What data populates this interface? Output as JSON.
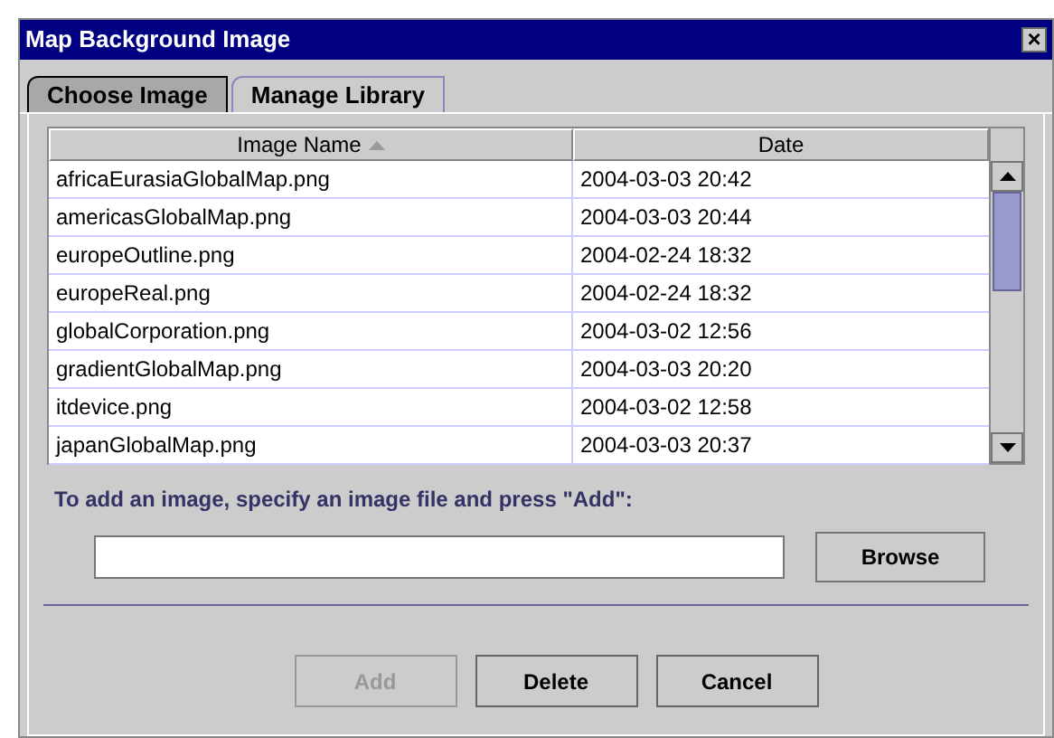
{
  "window": {
    "title": "Map Background Image",
    "close": "×"
  },
  "tabs": [
    {
      "label": "Choose Image",
      "selected": true
    },
    {
      "label": "Manage Library",
      "selected": false
    }
  ],
  "table": {
    "columns": [
      {
        "label": "Image Name",
        "sorted": true
      },
      {
        "label": "Date",
        "sorted": false
      }
    ],
    "rows": [
      [
        "africaEurasiaGlobalMap.png",
        "2004-03-03 20:42"
      ],
      [
        "americasGlobalMap.png",
        "2004-03-03 20:44"
      ],
      [
        "europeOutline.png",
        "2004-02-24 18:32"
      ],
      [
        "europeReal.png",
        "2004-02-24 18:32"
      ],
      [
        "globalCorporation.png",
        "2004-03-02 12:56"
      ],
      [
        "gradientGlobalMap.png",
        "2004-03-03 20:20"
      ],
      [
        "itdevice.png",
        "2004-03-02 12:58"
      ],
      [
        "japanGlobalMap.png",
        "2004-03-03 20:37"
      ]
    ]
  },
  "instruction": "To add an image, specify an image file and press \"Add\":",
  "browse_button": {
    "label": "Browse"
  },
  "buttons": [
    {
      "label": "Add",
      "disabled": true
    },
    {
      "label": "Delete",
      "disabled": false
    },
    {
      "label": "Cancel",
      "disabled": false
    }
  ]
}
